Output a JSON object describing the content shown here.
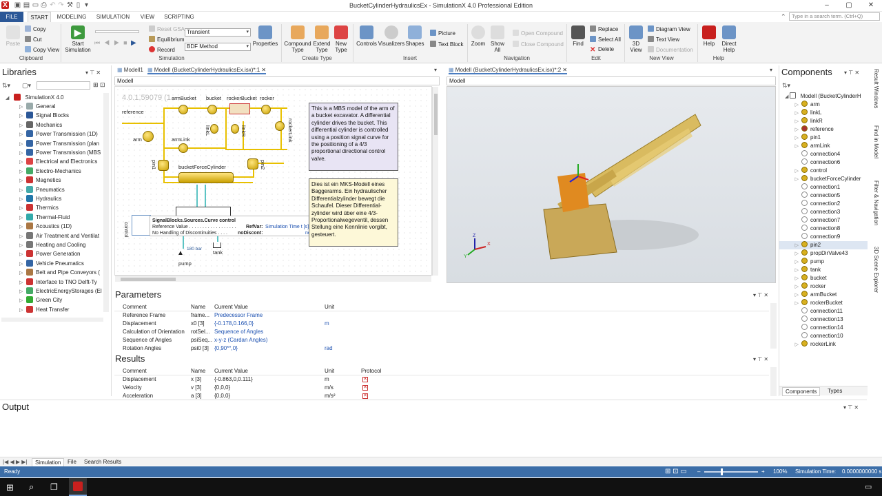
{
  "window": {
    "title": "BucketCylinderHydraulicsEx - SimulationX 4.0 Professional Edition",
    "search_placeholder": "Type in a search term. (Ctrl+Q)"
  },
  "ribbon_tabs": [
    "FILE",
    "START",
    "MODELING",
    "SIMULATION",
    "VIEW",
    "SCRIPTING"
  ],
  "ribbon": {
    "clipboard": {
      "paste": "Paste",
      "copy": "Copy",
      "cut": "Cut",
      "copy_view": "Copy View",
      "label": "Clipboard"
    },
    "simulation": {
      "start": "Start Simulation",
      "reset": "Reset GSA",
      "equilibrium": "Equilibrium",
      "record": "Record",
      "mode": "Transient",
      "method": "BDF Method",
      "properties": "Properties",
      "label": "Simulation"
    },
    "create": {
      "compound": "Compound Type",
      "extend": "Extend Type",
      "new": "New Type",
      "label": "Create Type"
    },
    "insert": {
      "controls": "Controls",
      "visualizers": "Visualizers",
      "shapes": "Shapes",
      "picture": "Picture",
      "text_block": "Text Block",
      "label": "Insert"
    },
    "navigation": {
      "zoom": "Zoom",
      "show_all": "Show All",
      "open_compound": "Open Compound",
      "close_compound": "Close Compound",
      "label": "Navigation"
    },
    "edit": {
      "find": "Find",
      "replace": "Replace",
      "select_all": "Select All",
      "delete": "Delete",
      "label": "Edit"
    },
    "newview": {
      "view3d": "3D View",
      "diagram_view": "Diagram View",
      "text_view": "Text View",
      "documentation": "Documentation",
      "label": "New View"
    },
    "help": {
      "help": "Help",
      "direct_help": "Direct Help",
      "label": "Help"
    }
  },
  "libraries": {
    "title": "Libraries",
    "root": "SimulationX 4.0",
    "items": [
      "General",
      "Signal Blocks",
      "Mechanics",
      "Power Transmission (1D)",
      "Power Transmission (plan",
      "Power Transmission (MBS",
      "Electrical and Electronics",
      "Electro-Mechanics",
      "Magnetics",
      "Pneumatics",
      "Hydraulics",
      "Thermics",
      "Thermal-Fluid",
      "Acoustics (1D)",
      "Air Treatment and Ventilat",
      "Heating and Cooling",
      "Power Generation",
      "Vehicle Pneumatics",
      "Belt and Pipe Conveyors (",
      "Interface to TNO Delft-Ty",
      "ElectricEnergyStorages (El",
      "Green City",
      "Heat Transfer"
    ]
  },
  "doc_tabs": {
    "left": [
      "Modell1",
      "Modell (BucketCylinderHydraulicsEx.isx)*:1"
    ],
    "right": [
      "Modell (BucketCylinderHydraulicsEx.isx)*:2"
    ],
    "breadcrumb_left": "Modell",
    "breadcrumb_right": "Modell"
  },
  "diagram": {
    "version": "4.0.1.59079 (1",
    "labels": {
      "reference": "reference",
      "arm": "arm",
      "armBucket": "armBucket",
      "bucket": "bucket",
      "rockerBucket": "rockerBucket",
      "rocker": "rocker",
      "rockerLink": "rockerLink",
      "linkL": "linkL",
      "linkR": "linkR",
      "armLink": "armLink",
      "pin1": "pin1",
      "pin2": "pin2",
      "bucketForceCylinder": "bucketForceCylinder",
      "control": "control",
      "pump": "pump",
      "tank": "tank",
      "pressure": "180 bar"
    },
    "tooltip": {
      "line1": "SignalBlocks.Sources.Curve control",
      "line2": "Reference Value . . . . . . . . . . . . . . . . . .",
      "line2_key": "RefVar:",
      "line2_val": "Simulation Time t [s]",
      "line3": "No Handling of Discontinuities . . . .",
      "line3_key": "noDiscont:",
      "line3_val": "no"
    },
    "note_en": "This is a MBS model of the arm of a bucket excavator. A differential cylinder drives the bucket. This differential cylinder is controlled using a position signal curve for the positioning of a 4/3 proportional directional control valve.",
    "note_de": "Dies ist ein MKS-Modell eines Baggerarms. Ein hydraulischer Differentialzylinder bewegt die Schaufel. Dieser Differential-zylinder wird über eine 4/3-Proportionalwegeventil, dessen Stellung eine Kennlinie vorgibt, gesteuert."
  },
  "components": {
    "title": "Components",
    "root": "Modell (BucketCylinderH",
    "items": [
      "arm",
      "linkL",
      "linkR",
      "reference",
      "pin1",
      "armLink",
      "connection4",
      "connection6",
      "control",
      "bucketForceCylinder",
      "connection1",
      "connection5",
      "connection2",
      "connection3",
      "connection7",
      "connection8",
      "connection9",
      "pin2",
      "propDirValve43",
      "pump",
      "tank",
      "bucket",
      "rocker",
      "armBucket",
      "rockerBucket",
      "connection11",
      "connection13",
      "connection14",
      "connection10",
      "rockerLink"
    ],
    "selected_index": 17,
    "bottom_tabs": [
      "Components",
      "Types"
    ]
  },
  "side_tabs": [
    "Result Windows",
    "Find in Model",
    "Filter & Navigation",
    "3D Scene Explorer"
  ],
  "parameters": {
    "title": "Parameters",
    "headers": [
      "Comment",
      "Name",
      "Current Value",
      "Unit"
    ],
    "rows": [
      [
        "Reference Frame",
        "frame...",
        "Predecessor Frame",
        ""
      ],
      [
        "Displacement",
        "x0 [3]",
        "{-0.178,0.166,0}",
        "m"
      ],
      [
        "Calculation of Orientation",
        "rotSel...",
        "Sequence of Angles",
        ""
      ],
      [
        "Sequence of Angles",
        "psiSeq...",
        "x-y-z (Cardan Angles)",
        ""
      ],
      [
        "Rotation Angles",
        "psi0 [3]",
        "{0,90*°,0}",
        "rad"
      ]
    ]
  },
  "results": {
    "title": "Results",
    "headers": [
      "Comment",
      "Name",
      "Current Value",
      "Unit",
      "Protocol"
    ],
    "rows": [
      [
        "Displacement",
        "x [3]",
        "{-0.863,0,0.111}",
        "m"
      ],
      [
        "Velocity",
        "v [3]",
        "{0,0,0}",
        "m/s"
      ],
      [
        "Acceleration",
        "a [3]",
        "{0,0,0}",
        "m/s²"
      ]
    ]
  },
  "output": {
    "title": "Output",
    "tabs": [
      "Simulation",
      "File",
      "Search Results"
    ]
  },
  "status": {
    "left": "Ready",
    "zoom": "100%",
    "sim_time_label": "Simulation Time:",
    "sim_time_value": "0.0000000000 s"
  },
  "colors": {
    "accent": "#2b5797",
    "status": "#3c6ea8",
    "wire": "#e8c000",
    "note_en_bg": "#e8e4f4",
    "note_de_bg": "#fdf8d8"
  }
}
